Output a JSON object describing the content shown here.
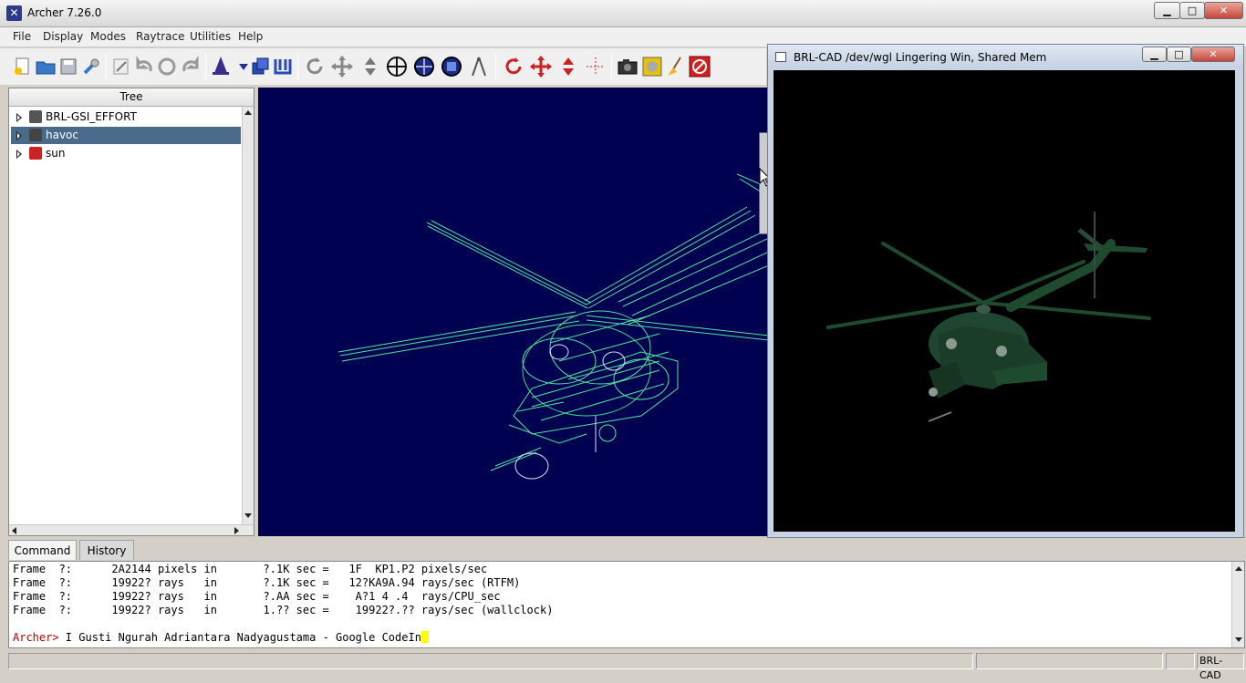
{
  "window": {
    "title": "Archer 7.26.0",
    "controls": {
      "minimize": "▁",
      "maximize": "□",
      "close": "✕"
    }
  },
  "menu": [
    "File",
    "Display",
    "Modes",
    "Raytrace",
    "Utilities",
    "Help"
  ],
  "toolbar": {
    "icons": [
      "new-file-icon",
      "open-folder-icon",
      "save-icon",
      "preferences-wrench-icon",
      "edit-icon",
      "undo-icon",
      "revert-icon",
      "redo-icon",
      "wizard-icon",
      "dropdown-arrow-icon",
      "copy-object-icon",
      "binding-icon",
      "rotate-view-icon",
      "translate-view-icon",
      "scale-view-icon",
      "center-view-icon",
      "zoom-in-icon",
      "zoom-out-icon",
      "measure-compass-icon",
      "rotate-object-icon",
      "translate-object-icon",
      "scale-object-icon",
      "center-object-icon",
      "raytrace-camera-icon",
      "framebuffer-icon",
      "clear-broom-icon",
      "abort-icon"
    ]
  },
  "tree": {
    "header": "Tree",
    "items": [
      {
        "label": "BRL-GSI_EFFORT",
        "icon": "combination-icon",
        "color": "#555555",
        "selected": false
      },
      {
        "label": "havoc",
        "icon": "combination-icon",
        "color": "#444444",
        "selected": true
      },
      {
        "label": "sun",
        "icon": "region-icon",
        "color": "#cc2222",
        "selected": false
      }
    ]
  },
  "raytrace_window": {
    "title": "BRL-CAD /dev/wgl Lingering Win, Shared Mem",
    "controls": {
      "minimize": "▁",
      "maximize": "□",
      "close": "✕"
    }
  },
  "command": {
    "tabs": [
      "Command",
      "History"
    ],
    "lines": [
      "Frame  ?:      2A2144 pixels in       ?.1K sec =   1F  KP1.P2 pixels/sec",
      "Frame  ?:      19922? rays   in       ?.1K sec =   12?KA9A.94 rays/sec (RTFM)",
      "Frame  ?:      19922? rays   in       ?.AA sec =    A?1 4 .4  rays/CPU_sec",
      "Frame  ?:      19922? rays   in       1.?? sec =    19922?.?? rays/sec (wallclock)"
    ],
    "prompt": "Archer>",
    "input": " I Gusti Ngurah Adriantara Nadyagustama - Google CodeIn"
  },
  "status": {
    "label": "BRL-CAD"
  },
  "colors": {
    "viewport_bg": "#000050",
    "wireframe": "#4ee6a0",
    "render_body": "#1e4a30",
    "selection": "#4a6a8c",
    "prompt": "#c00000"
  }
}
